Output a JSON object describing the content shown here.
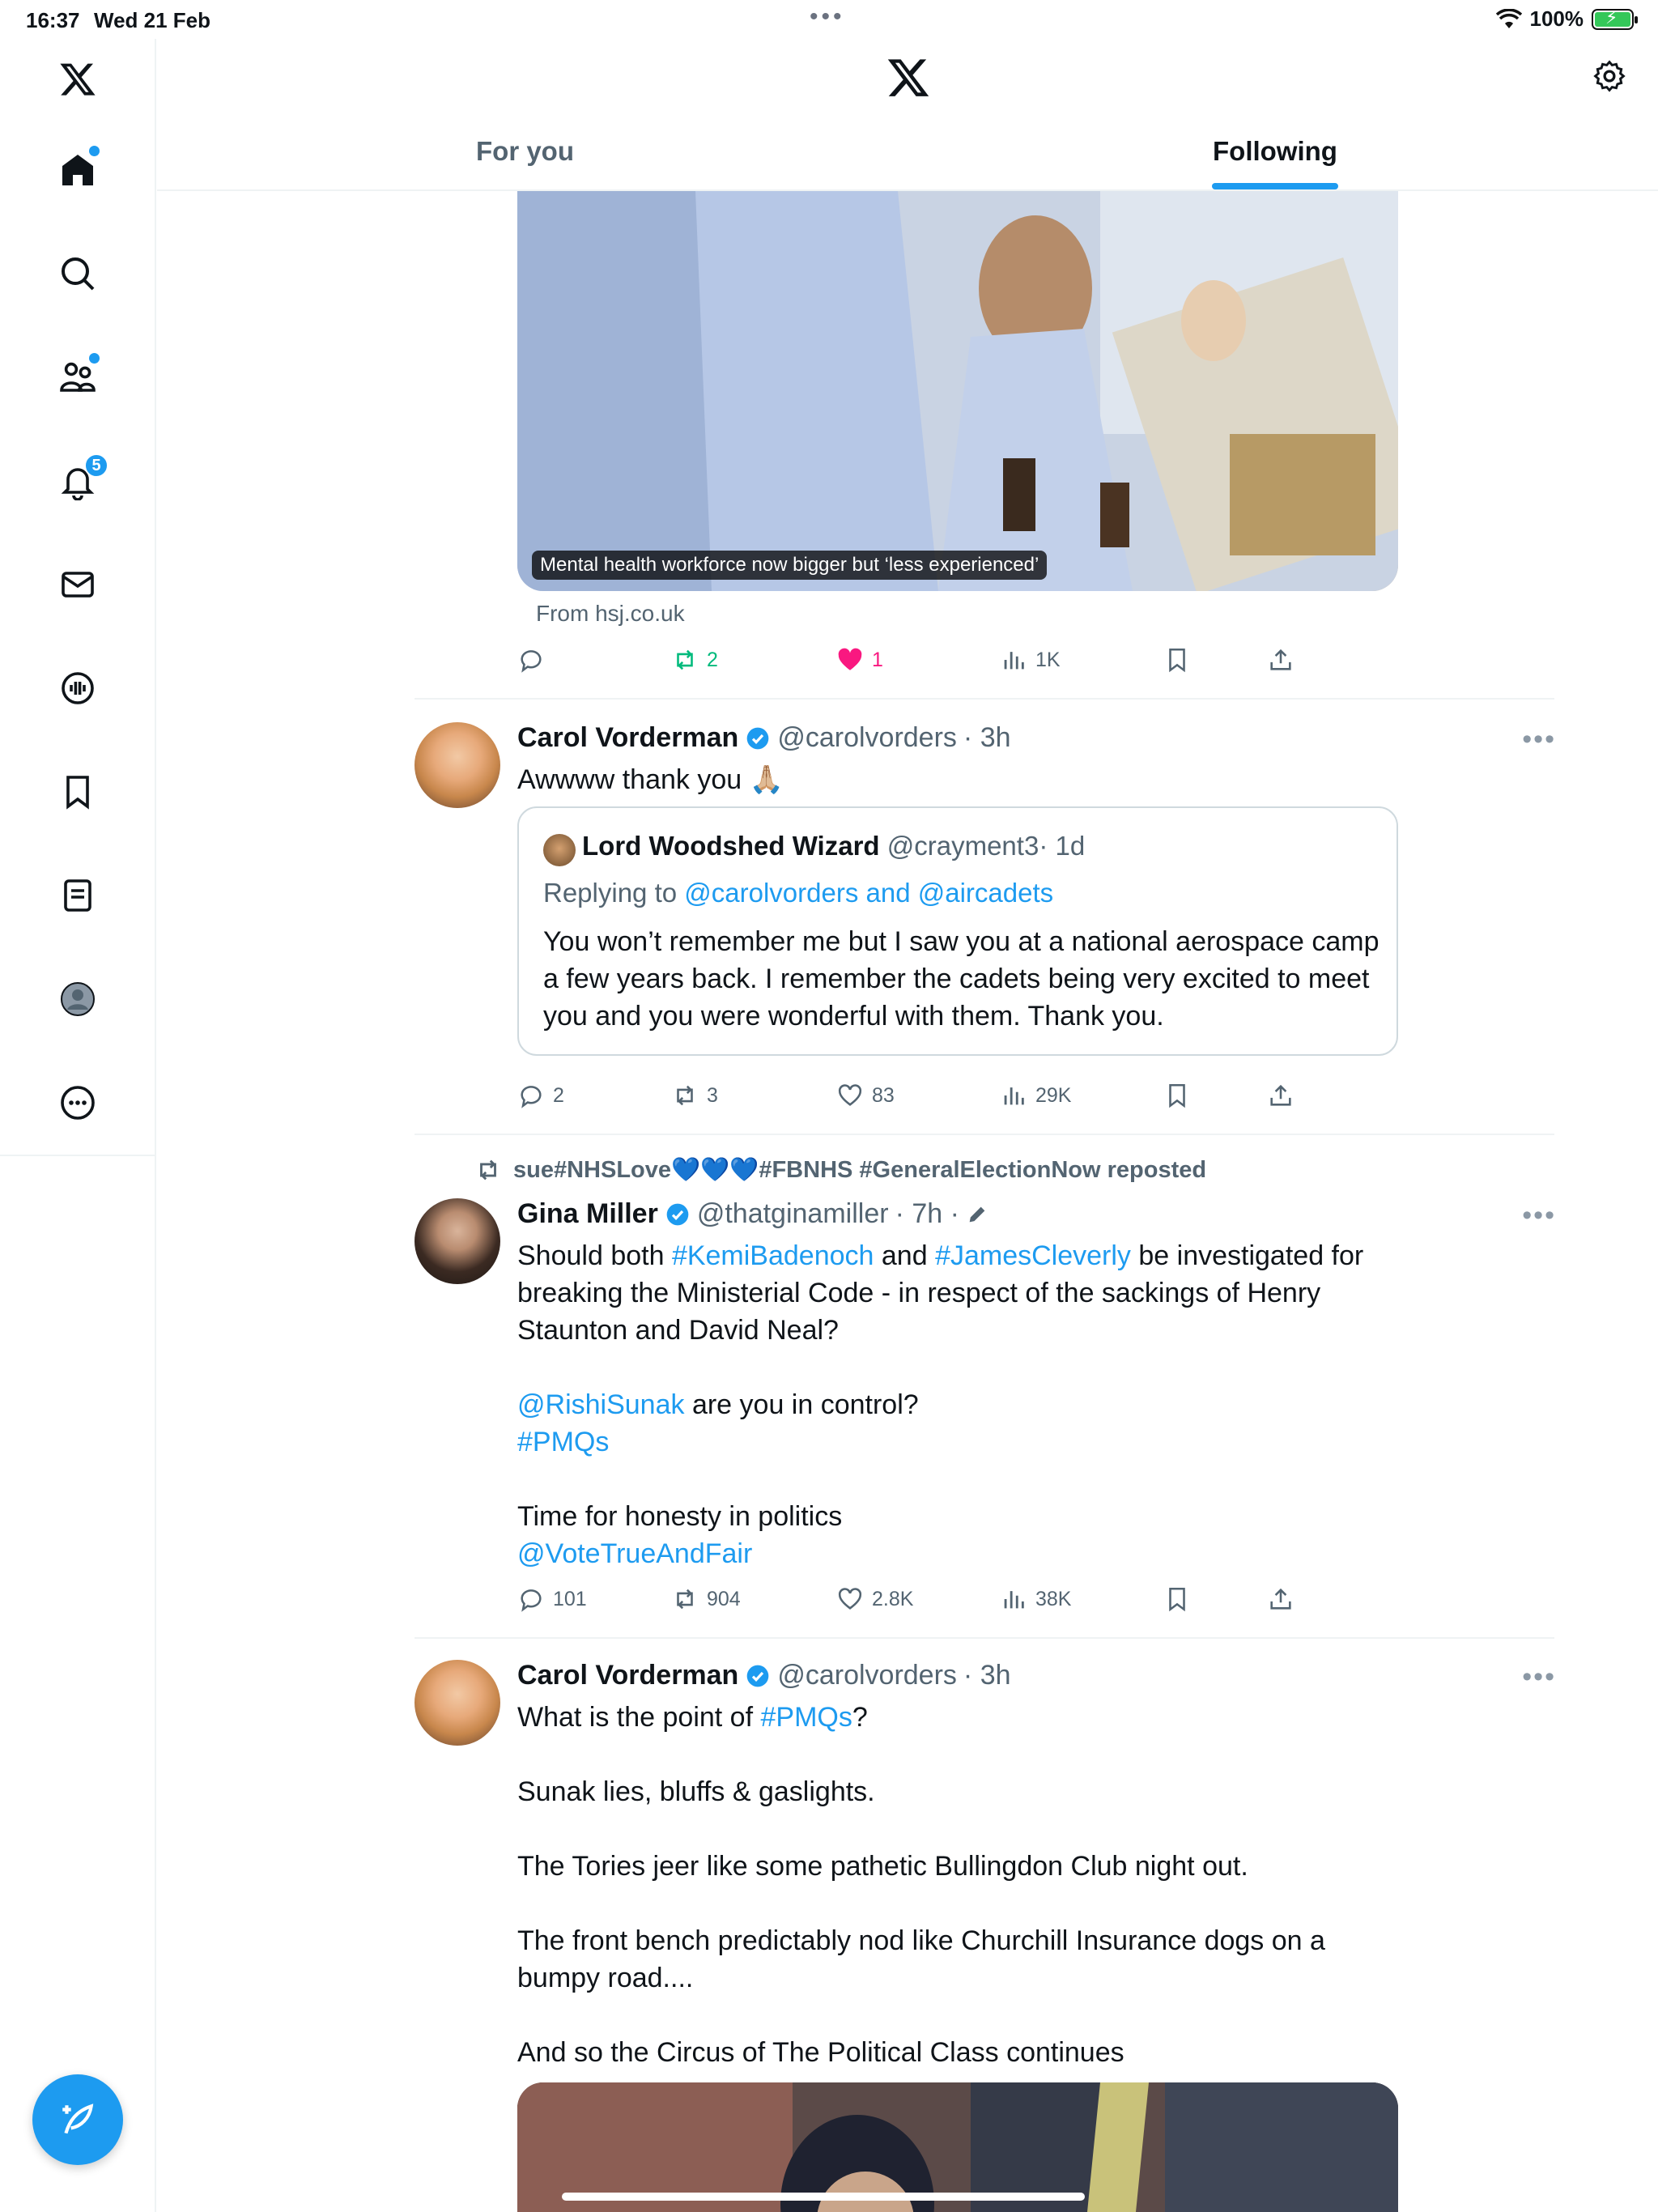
{
  "status": {
    "time": "16:37",
    "date": "Wed 21 Feb",
    "battery": "100%"
  },
  "sidebar": {
    "items": [
      "home",
      "search",
      "communities",
      "notifications",
      "messages",
      "spaces",
      "bookmarks",
      "lists",
      "profile",
      "more"
    ],
    "notifications_badge": "5"
  },
  "header": {
    "tab_foryou": "For you",
    "tab_following": "Following"
  },
  "card": {
    "caption": "Mental health workforce now bigger but ‘less experienced’",
    "source": "From hsj.co.uk"
  },
  "card_actions": {
    "replies": "",
    "reposts": "2",
    "likes": "1",
    "views": "1K"
  },
  "tweet1": {
    "name": "Carol Vorderman",
    "handle": "@carolvorders",
    "time": "· 3h",
    "text": "Awwww thank you 🙏🏼",
    "quote": {
      "name": "Lord Woodshed Wizard",
      "handle": "@crayment3",
      "time": "· 1d",
      "replying_prefix": "Replying to ",
      "replying_to": "@carolvorders and @aircadets",
      "text": "You won’t remember me but I saw you at a national aerospace camp a few years back. I remember the cadets being very excited to meet you and you were wonderful with them. Thank you."
    },
    "actions": {
      "replies": "2",
      "reposts": "3",
      "likes": "83",
      "views": "29K"
    }
  },
  "tweet2": {
    "reposted_by": "sue#NHSLove💙💙💙#FBNHS #GeneralElectionNow reposted",
    "name": "Gina Miller",
    "handle": "@thatginamiller",
    "time": "· 7h ·",
    "line1_a": "Should both ",
    "line1_link1": "#KemiBadenoch",
    "line1_b": " and ",
    "line1_link2": "#JamesCleverly",
    "line1_c": " be investigated for",
    "line2": "breaking the Ministerial Code  - in respect of the sackings of Henry",
    "line3": "Staunton and David Neal?",
    "line4_link": "@RishiSunak",
    "line4_text": " are you in control?",
    "line5_link": "#PMQs",
    "line6": "Time for honesty in politics",
    "line7_link": "@VoteTrueAndFair",
    "actions": {
      "replies": "101",
      "reposts": "904",
      "likes": "2.8K",
      "views": "38K"
    }
  },
  "tweet3": {
    "name": "Carol Vorderman",
    "handle": "@carolvorders",
    "time": "· 3h",
    "line1_a": "What is the point of ",
    "line1_link": "#PMQs",
    "line1_b": "?",
    "line2": "Sunak lies, bluffs & gaslights.",
    "line3": "The Tories jeer like some pathetic Bullingdon Club night out.",
    "line4": "The front bench predictably nod like Churchill Insurance dogs on a",
    "line5": "bumpy road....",
    "line6": "And so the Circus of The Political Class continues"
  },
  "colors": {
    "accent": "#1d9bf0",
    "like": "#f91880",
    "repost": "#00ba7c",
    "muted": "#536471"
  }
}
